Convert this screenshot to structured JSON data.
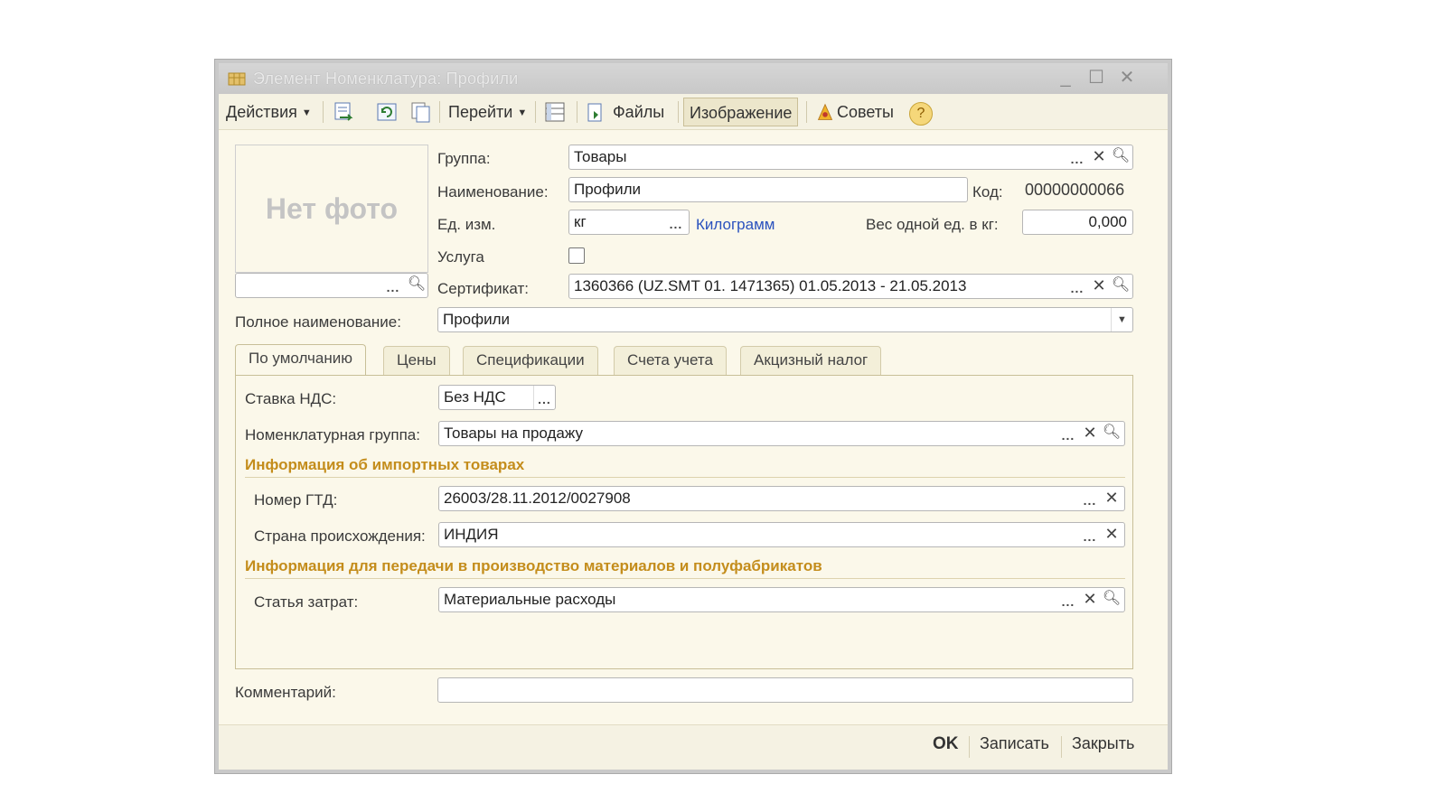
{
  "window": {
    "title": "Элемент Номенклатура: Профили"
  },
  "toolbar": {
    "actions_label": "Действия",
    "goto_label": "Перейти",
    "files_label": "Файлы",
    "image_label": "Изображение",
    "tips_label": "Советы",
    "help_label": "?"
  },
  "photo": {
    "placeholder": "Нет фото"
  },
  "form": {
    "group": {
      "label": "Группа:",
      "value": "Товары"
    },
    "name": {
      "label": "Наименование:",
      "value": "Профили"
    },
    "code": {
      "label": "Код:",
      "value": "00000000066"
    },
    "unit": {
      "label": "Ед. изм.",
      "value": "кг",
      "link": "Килограмм"
    },
    "weight": {
      "label": "Вес одной ед. в кг:",
      "value": "0,000"
    },
    "service": {
      "label": "Услуга",
      "checked": false
    },
    "certificate": {
      "label": "Сертификат:",
      "value": "1360366 (UZ.SMT 01.  1471365) 01.05.2013 - 21.05.2013"
    },
    "full_name": {
      "label": "Полное наименование:",
      "value": "Профили"
    }
  },
  "tabs": [
    {
      "label": "По умолчанию",
      "active": true
    },
    {
      "label": "Цены",
      "active": false
    },
    {
      "label": "Спецификации",
      "active": false
    },
    {
      "label": "Счета учета",
      "active": false
    },
    {
      "label": "Акцизный налог",
      "active": false
    }
  ],
  "defaults_tab": {
    "vat": {
      "label": "Ставка НДС:",
      "value": "Без НДС"
    },
    "nom_group": {
      "label": "Номенклатурная группа:",
      "value": "Товары на продажу"
    },
    "import_section": "Информация об импортных товарах",
    "gtd": {
      "label": "Номер ГТД:",
      "value": "26003/28.11.2012/0027908"
    },
    "country": {
      "label": "Страна происхождения:",
      "value": "ИНДИЯ"
    },
    "production_section": "Информация для передачи в производство материалов и полуфабрикатов",
    "cost_item": {
      "label": "Статья затрат:",
      "value": "Материальные расходы"
    }
  },
  "comment": {
    "label": "Комментарий:",
    "value": ""
  },
  "footer": {
    "ok_label": "OK",
    "save_label": "Записать",
    "close_label": "Закрыть"
  }
}
